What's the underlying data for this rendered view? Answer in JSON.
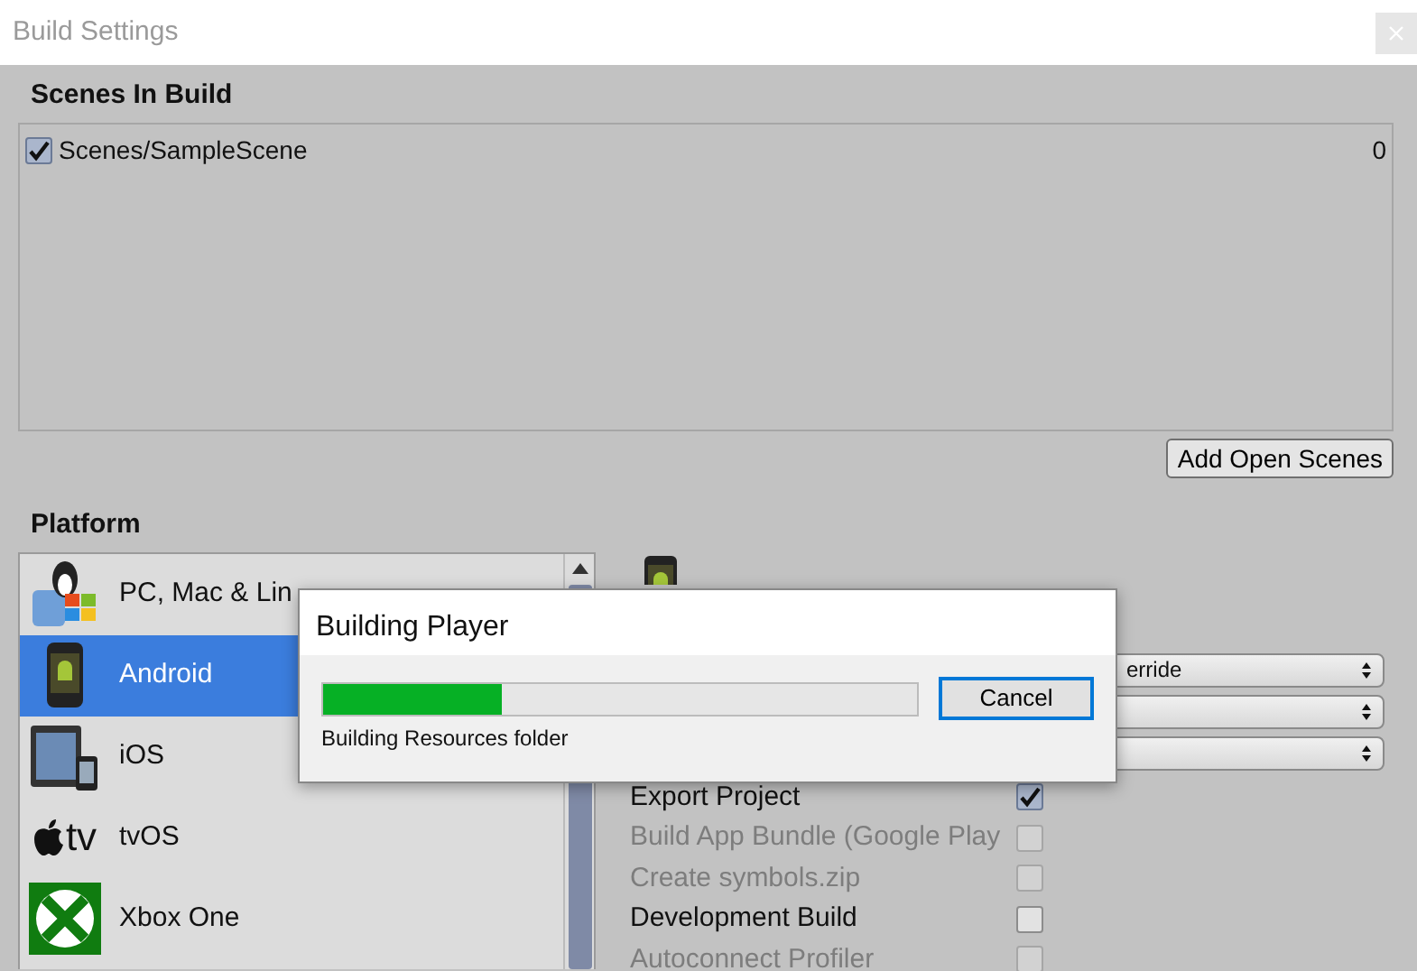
{
  "window": {
    "title": "Build Settings"
  },
  "scenes_in_build": {
    "heading": "Scenes In Build",
    "scenes": [
      {
        "name": "Scenes/SampleScene",
        "index": "0",
        "checked": true
      }
    ],
    "add_button": "Add Open Scenes"
  },
  "platform": {
    "heading": "Platform",
    "platforms": [
      {
        "name": "PC, Mac & Lin",
        "kind": "pc",
        "selected": false
      },
      {
        "name": "Android",
        "kind": "android",
        "selected": true
      },
      {
        "name": "iOS",
        "kind": "ios",
        "selected": false
      },
      {
        "name": "tvOS",
        "kind": "tvos",
        "logo_text": "tv",
        "selected": false
      },
      {
        "name": "Xbox One",
        "kind": "xbox",
        "selected": false
      }
    ]
  },
  "settings": {
    "dropdowns": [
      {
        "kind": "text",
        "value": "erride"
      },
      {
        "kind": "empty"
      },
      {
        "kind": "empty"
      }
    ],
    "options": [
      {
        "label": "Export Project",
        "checked": true,
        "disabled": false
      },
      {
        "label": "Build App Bundle (Google Play",
        "checked": false,
        "disabled": true
      },
      {
        "label": "Create symbols.zip",
        "checked": false,
        "disabled": true
      },
      {
        "label": "Development Build",
        "checked": false,
        "disabled": false
      },
      {
        "label": "Autoconnect Profiler",
        "checked": false,
        "disabled": true
      }
    ]
  },
  "dialog": {
    "title": "Building Player",
    "level": 0.3,
    "status": "Building Resources folder",
    "button": "Cancel"
  }
}
